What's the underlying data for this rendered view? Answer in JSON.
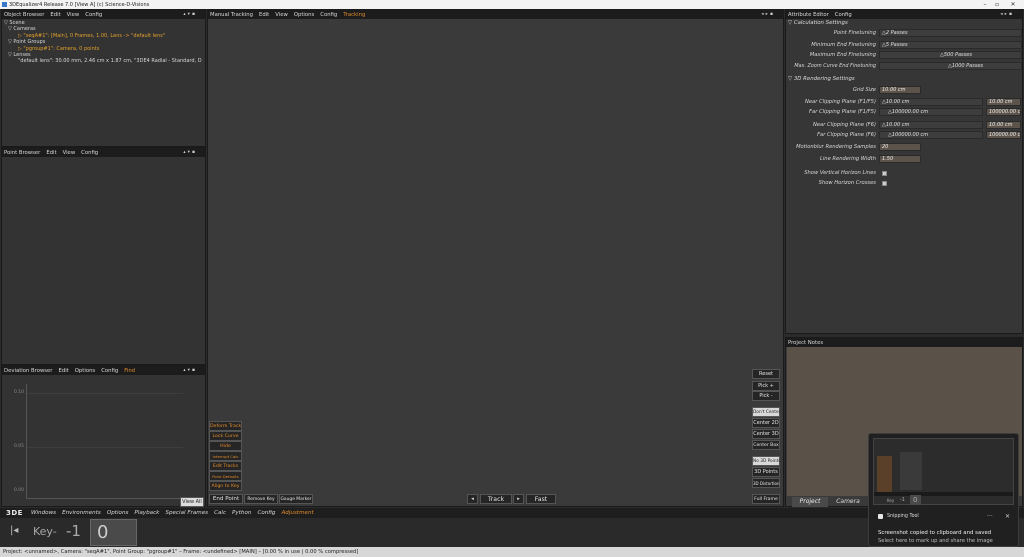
{
  "window": {
    "title": "3DEqualizer4 Release 7.0 [View A]   (c) Science-D-Visions",
    "min": "–",
    "max": "▫",
    "close": "✕"
  },
  "object_browser": {
    "menu": [
      "Object Browser",
      "Edit",
      "View",
      "Config"
    ],
    "tree": {
      "scene": "▽ Scene",
      "cameras": "▽ Cameras",
      "camera_item": "▷ \"seqA#1\": [Main], 0 Frames, 1.00, Lens -> \"default lens\"",
      "point_groups": "▽ Point Groups",
      "pgroup_item": "▷ \"pgroup#1\": Camera, 0 points",
      "lenses": "▽ Lenses",
      "lens_item": "\"default lens\": 30.00 mm, 2.46 cm x 1.87 cm, \"3DE4 Radial - Standard, D"
    }
  },
  "point_browser": {
    "menu": [
      "Point Browser",
      "Edit",
      "View",
      "Config"
    ]
  },
  "deviation_browser": {
    "menu": [
      "Deviation Browser",
      "Edit",
      "Options",
      "Config"
    ],
    "active": "Find",
    "ticks": [
      "0.10",
      "0.05",
      "0.00"
    ],
    "view_all": "View All"
  },
  "manual_tracking": {
    "menu": [
      "Manual Tracking",
      "Edit",
      "View",
      "Options",
      "Config"
    ],
    "active": "Tracking",
    "left_buttons": [
      "Deform Track",
      "Lock Curve",
      "Hide",
      "Interrupt Calc",
      "Edit Tracks",
      "Point Defaults",
      "Align to Key"
    ],
    "right_buttons": [
      "Reset",
      "Pick +",
      "Pick -",
      "Don't Center",
      "Center 2D",
      "Center 3D",
      "Center Box",
      "No 3D Points",
      "3D Points",
      "3D Distortion",
      "Full Frame"
    ],
    "bottom": {
      "end_point": "End Point",
      "remove_key": "Remove Key",
      "gauge_marker": "Gauge Marker",
      "prev": "◂",
      "track": "Track",
      "next": "▸",
      "fast": "Fast"
    }
  },
  "attribute_editor": {
    "menu": [
      "Attribute Editor",
      "Config"
    ],
    "calc_section": "▽ Calculation Settings",
    "calc_rows": [
      {
        "label": "Point Finetuning",
        "value": "△2 Passes"
      },
      {
        "label": "Minimum End Finetuning",
        "value": "△5 Passes"
      },
      {
        "label": "Maximum End Finetuning",
        "value": "△500 Passes"
      },
      {
        "label": "Max. Zoom Curve End Finetuning",
        "value": "△1000 Passes"
      }
    ],
    "render_section": "▽ 3D Rendering Settings",
    "grid_size": {
      "label": "Grid Size",
      "value": "10.00 cm"
    },
    "clip_rows": [
      {
        "label": "Near Clipping Plane (F1/F5)",
        "value": "△10.00 cm",
        "box": "10.00 cm"
      },
      {
        "label": "Far Clipping Plane (F1/F5)",
        "value": "△100000.00 cm",
        "box": "100000.00 c"
      },
      {
        "label": "Near Clipping Plane (F6)",
        "value": "△10.00 cm",
        "box": "10.00 cm"
      },
      {
        "label": "Far Clipping Plane (F6)",
        "value": "△100000.00 cm",
        "box": "100000.00 c"
      }
    ],
    "motionblur": {
      "label": "Motionblur Rendering Samples",
      "value": "20"
    },
    "line_width": {
      "label": "Line Rendering Width",
      "value": "1.50"
    },
    "vertical_horizon": "Show Vertical Horizon Lines",
    "horizon_crosses": "Show Horizon Crosses"
  },
  "project_notes": {
    "title": "Project Notes",
    "tabs": [
      "Project",
      "Camera",
      "P"
    ]
  },
  "main_menu": {
    "logo": "3DE",
    "items": [
      "Windows",
      "Environments",
      "Options",
      "Playback",
      "Special Frames",
      "Calc",
      "Python",
      "Config"
    ],
    "active": "Adjustment"
  },
  "timeline": {
    "jump_icon": "|◂",
    "key_label": "Key-",
    "minus": "-1",
    "zero": "0"
  },
  "snipping_toast": {
    "thumb_key": "Key",
    "thumb_minus": "-1",
    "thumb_zero": "0",
    "app": "Snipping Tool",
    "dots": "···",
    "close": "✕",
    "line1": "Screenshot copied to clipboard and saved",
    "line2": "Select here to mark up and share the image"
  },
  "status": "Project: <unnamed>, Camera: \"seqA#1\", Point Group: \"pgroup#1\" – Frame: <undefined> [MAIN] – [0.00 % in use | 0.00 % compressed]",
  "colors": {
    "accent": "#e38b2c",
    "panel": "#333333",
    "header": "#1c1c1c"
  }
}
